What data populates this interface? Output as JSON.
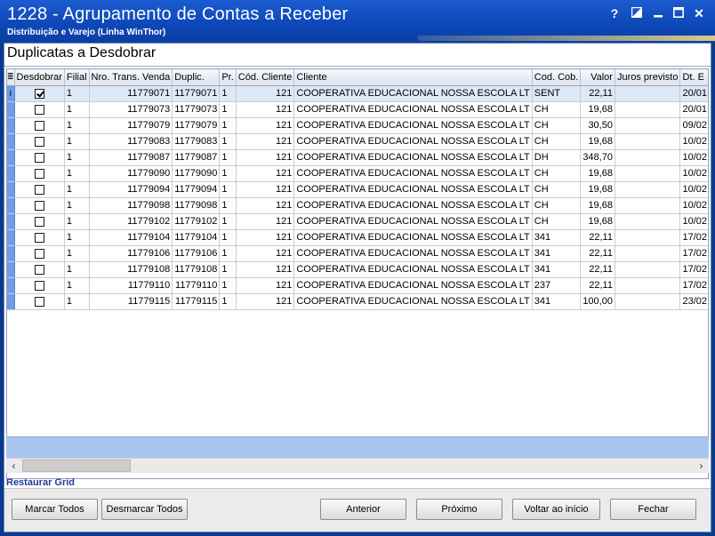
{
  "window": {
    "title": "1228 - Agrupamento de Contas a Receber",
    "subtitle": "Distribuição e Varejo (Linha WinThor)",
    "help_glyph": "?",
    "close_glyph": "✕"
  },
  "section_title": "Duplicatas a Desdobrar",
  "grid": {
    "columns": {
      "desdobrar": "Desdobrar",
      "filial": "Filial",
      "nro_trans": "Nro. Trans. Venda",
      "duplic": "Duplic.",
      "pr": "Pr.",
      "cod_cliente": "Cód. Cliente",
      "cliente": "Cliente",
      "cod_cob": "Cod. Cob.",
      "valor": "Valor",
      "juros": "Juros previsto",
      "dt": "Dt. E"
    },
    "row_indicator": "I",
    "rows": [
      {
        "checked": true,
        "filial": "1",
        "nro_trans": "11779071",
        "duplic": "11779071",
        "pr": "1",
        "cod_cliente": "121",
        "cliente": "COOPERATIVA EDUCACIONAL NOSSA ESCOLA LT",
        "cod_cob": "SENT",
        "valor": "22,11",
        "juros": "",
        "dt": "20/01"
      },
      {
        "checked": false,
        "filial": "1",
        "nro_trans": "11779073",
        "duplic": "11779073",
        "pr": "1",
        "cod_cliente": "121",
        "cliente": "COOPERATIVA EDUCACIONAL NOSSA ESCOLA LT",
        "cod_cob": "CH",
        "valor": "19,68",
        "juros": "",
        "dt": "20/01"
      },
      {
        "checked": false,
        "filial": "1",
        "nro_trans": "11779079",
        "duplic": "11779079",
        "pr": "1",
        "cod_cliente": "121",
        "cliente": "COOPERATIVA EDUCACIONAL NOSSA ESCOLA LT",
        "cod_cob": "CH",
        "valor": "30,50",
        "juros": "",
        "dt": "09/02"
      },
      {
        "checked": false,
        "filial": "1",
        "nro_trans": "11779083",
        "duplic": "11779083",
        "pr": "1",
        "cod_cliente": "121",
        "cliente": "COOPERATIVA EDUCACIONAL NOSSA ESCOLA LT",
        "cod_cob": "CH",
        "valor": "19,68",
        "juros": "",
        "dt": "10/02"
      },
      {
        "checked": false,
        "filial": "1",
        "nro_trans": "11779087",
        "duplic": "11779087",
        "pr": "1",
        "cod_cliente": "121",
        "cliente": "COOPERATIVA EDUCACIONAL NOSSA ESCOLA LT",
        "cod_cob": "DH",
        "valor": "348,70",
        "juros": "",
        "dt": "10/02"
      },
      {
        "checked": false,
        "filial": "1",
        "nro_trans": "11779090",
        "duplic": "11779090",
        "pr": "1",
        "cod_cliente": "121",
        "cliente": "COOPERATIVA EDUCACIONAL NOSSA ESCOLA LT",
        "cod_cob": "CH",
        "valor": "19,68",
        "juros": "",
        "dt": "10/02"
      },
      {
        "checked": false,
        "filial": "1",
        "nro_trans": "11779094",
        "duplic": "11779094",
        "pr": "1",
        "cod_cliente": "121",
        "cliente": "COOPERATIVA EDUCACIONAL NOSSA ESCOLA LT",
        "cod_cob": "CH",
        "valor": "19,68",
        "juros": "",
        "dt": "10/02"
      },
      {
        "checked": false,
        "filial": "1",
        "nro_trans": "11779098",
        "duplic": "11779098",
        "pr": "1",
        "cod_cliente": "121",
        "cliente": "COOPERATIVA EDUCACIONAL NOSSA ESCOLA LT",
        "cod_cob": "CH",
        "valor": "19,68",
        "juros": "",
        "dt": "10/02"
      },
      {
        "checked": false,
        "filial": "1",
        "nro_trans": "11779102",
        "duplic": "11779102",
        "pr": "1",
        "cod_cliente": "121",
        "cliente": "COOPERATIVA EDUCACIONAL NOSSA ESCOLA LT",
        "cod_cob": "CH",
        "valor": "19,68",
        "juros": "",
        "dt": "10/02"
      },
      {
        "checked": false,
        "filial": "1",
        "nro_trans": "11779104",
        "duplic": "11779104",
        "pr": "1",
        "cod_cliente": "121",
        "cliente": "COOPERATIVA EDUCACIONAL NOSSA ESCOLA LT",
        "cod_cob": "341",
        "valor": "22,11",
        "juros": "",
        "dt": "17/02"
      },
      {
        "checked": false,
        "filial": "1",
        "nro_trans": "11779106",
        "duplic": "11779106",
        "pr": "1",
        "cod_cliente": "121",
        "cliente": "COOPERATIVA EDUCACIONAL NOSSA ESCOLA LT",
        "cod_cob": "341",
        "valor": "22,11",
        "juros": "",
        "dt": "17/02"
      },
      {
        "checked": false,
        "filial": "1",
        "nro_trans": "11779108",
        "duplic": "11779108",
        "pr": "1",
        "cod_cliente": "121",
        "cliente": "COOPERATIVA EDUCACIONAL NOSSA ESCOLA LT",
        "cod_cob": "341",
        "valor": "22,11",
        "juros": "",
        "dt": "17/02"
      },
      {
        "checked": false,
        "filial": "1",
        "nro_trans": "11779110",
        "duplic": "11779110",
        "pr": "1",
        "cod_cliente": "121",
        "cliente": "COOPERATIVA EDUCACIONAL NOSSA ESCOLA LT",
        "cod_cob": "237",
        "valor": "22,11",
        "juros": "",
        "dt": "17/02"
      },
      {
        "checked": false,
        "filial": "1",
        "nro_trans": "11779115",
        "duplic": "11779115",
        "pr": "1",
        "cod_cliente": "121",
        "cliente": "COOPERATIVA EDUCACIONAL NOSSA ESCOLA LT",
        "cod_cob": "341",
        "valor": "100,00",
        "juros": "",
        "dt": "23/02"
      }
    ]
  },
  "restore_grid": "Restaurar Grid",
  "buttons": {
    "marcar_todos": "Marcar Todos",
    "desmarcar_todos": "Desmarcar Todos",
    "anterior": "Anterior",
    "proximo": "Próximo",
    "voltar": "Voltar ao início",
    "fechar": "Fechar"
  },
  "colors": {
    "titlebar": "#0d47b7",
    "row_indicator": "#6f9ce6",
    "footer_band": "#a9c4ee"
  }
}
